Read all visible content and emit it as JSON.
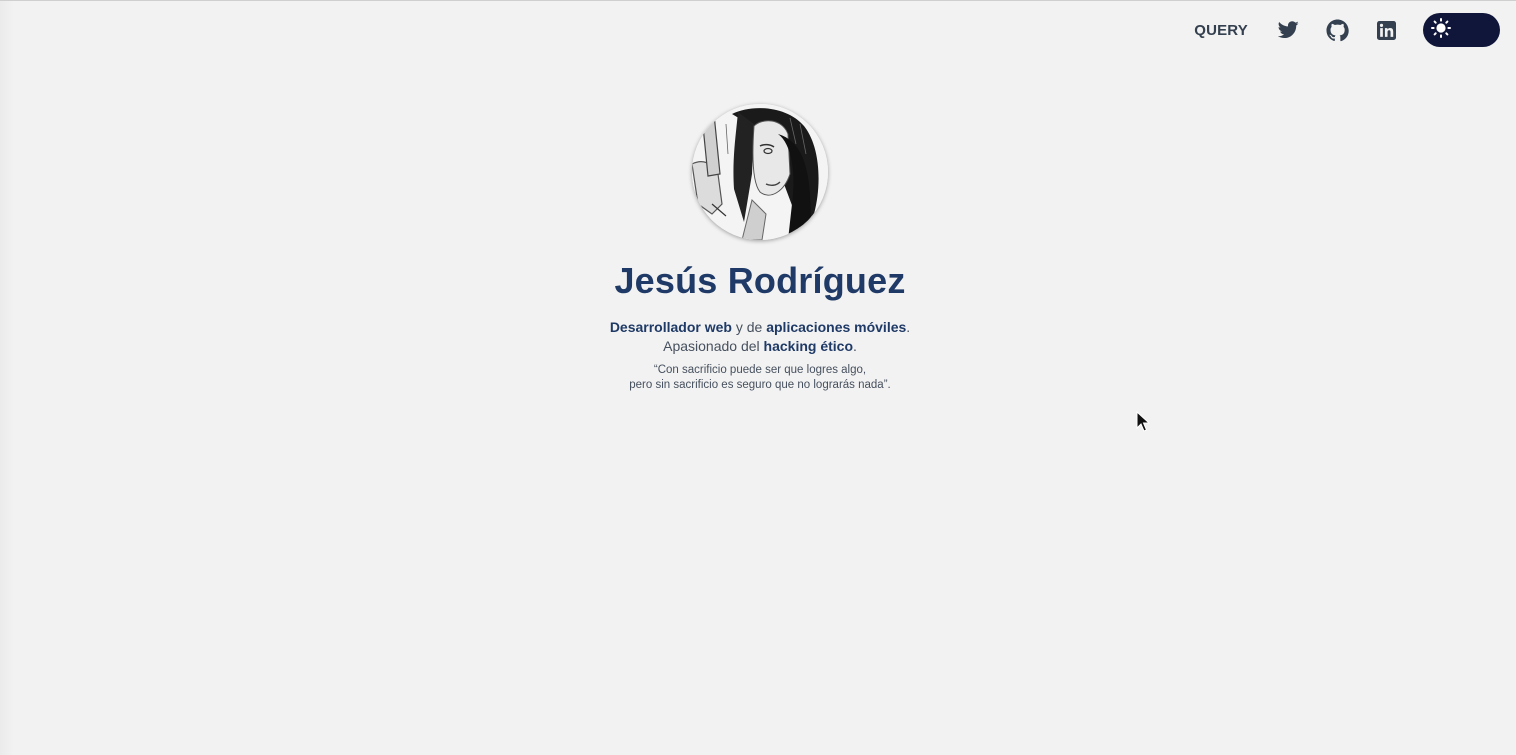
{
  "nav": {
    "query_label": "QUERY",
    "icons": [
      "twitter-icon",
      "github-icon",
      "linkedin-icon"
    ],
    "theme_icon": "sun-icon"
  },
  "profile": {
    "name": "Jesús Rodríguez",
    "bio_line1": {
      "part1": "Desarrollador web",
      "part2": " y de ",
      "part3": "aplicaciones móviles",
      "part4": "."
    },
    "bio_line2": {
      "part1": "Apasionado del ",
      "part2": "hacking ético",
      "part3": "."
    },
    "quote_line1": "“Con sacrificio puede ser que logres algo,",
    "quote_line2": "pero sin sacrificio es seguro que no lograrás nada”."
  },
  "colors": {
    "background": "#f2f2f2",
    "accent": "#1f3a66",
    "nav_text": "#34404f",
    "toggle_bg": "#10163a"
  }
}
